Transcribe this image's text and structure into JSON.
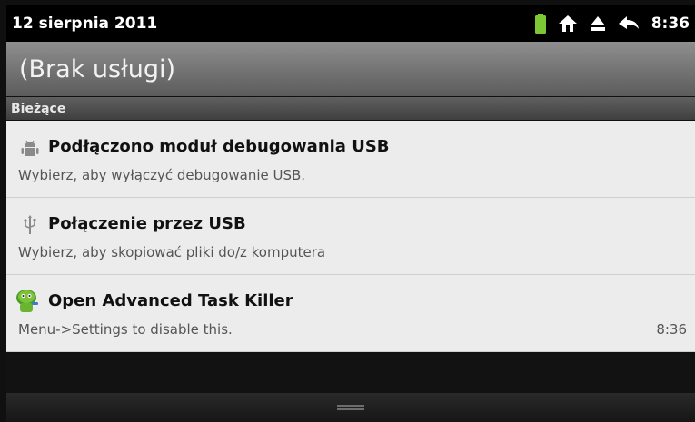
{
  "status_bar": {
    "date": "12 sierpnia 2011",
    "time": "8:36",
    "icons": [
      "battery-icon",
      "home-icon",
      "eject-icon",
      "back-arrow-icon"
    ],
    "battery_color": "#7ec734"
  },
  "carrier": {
    "label": "(Brak usługi)"
  },
  "section": {
    "label": "Bieżące"
  },
  "notifications": [
    {
      "icon": "android-debug-icon",
      "title": "Podłączono moduł debugowania USB",
      "subtitle": "Wybierz, aby wyłączyć debugowanie USB.",
      "time": ""
    },
    {
      "icon": "usb-icon",
      "title": "Połączenie przez USB",
      "subtitle": "Wybierz, aby skopiować pliki do/z komputera",
      "time": ""
    },
    {
      "icon": "task-killer-icon",
      "title": "Open Advanced Task Killer",
      "subtitle": "Menu->Settings to disable this.",
      "time": "8:36"
    }
  ]
}
